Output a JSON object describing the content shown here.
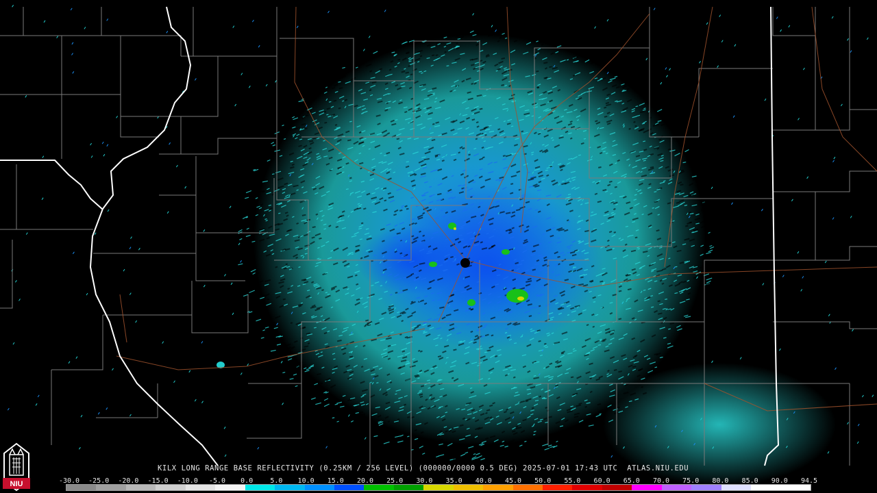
{
  "product_caption": "KILX LONG RANGE BASE REFLECTIVITY (0.25KM / 256 LEVEL) (000000/0000 0.5 DEG) 2025-07-01 17:43 UTC  ATLAS.NIU.EDU",
  "logo_text": "NIU",
  "scale": {
    "tick_labels": [
      "-30.0",
      "-25.0",
      "-20.0",
      "-15.0",
      "-10.0",
      "-5.0",
      "0.0",
      "5.0",
      "10.0",
      "15.0",
      "20.0",
      "25.0",
      "30.0",
      "35.0",
      "40.0",
      "45.0",
      "50.0",
      "55.0",
      "60.0",
      "65.0",
      "70.0",
      "75.0",
      "80.0",
      "85.0",
      "90.0",
      "94.5"
    ],
    "colors": [
      "#8a8a8a",
      "#a0a0a0",
      "#b8b8b8",
      "#cfcfcf",
      "#e4e4e4",
      "#f4f4f4",
      "#00e8e8",
      "#00b8f0",
      "#0090ff",
      "#0050ff",
      "#00c000",
      "#00a000",
      "#d8d800",
      "#f0c000",
      "#ffa000",
      "#ff7000",
      "#ff2000",
      "#e00000",
      "#c00000",
      "#ff00ff",
      "#c060ff",
      "#a080ff",
      "#e0e0ff",
      "#ffffff",
      "#ffffff"
    ]
  },
  "radar_site_marker": "KILX"
}
